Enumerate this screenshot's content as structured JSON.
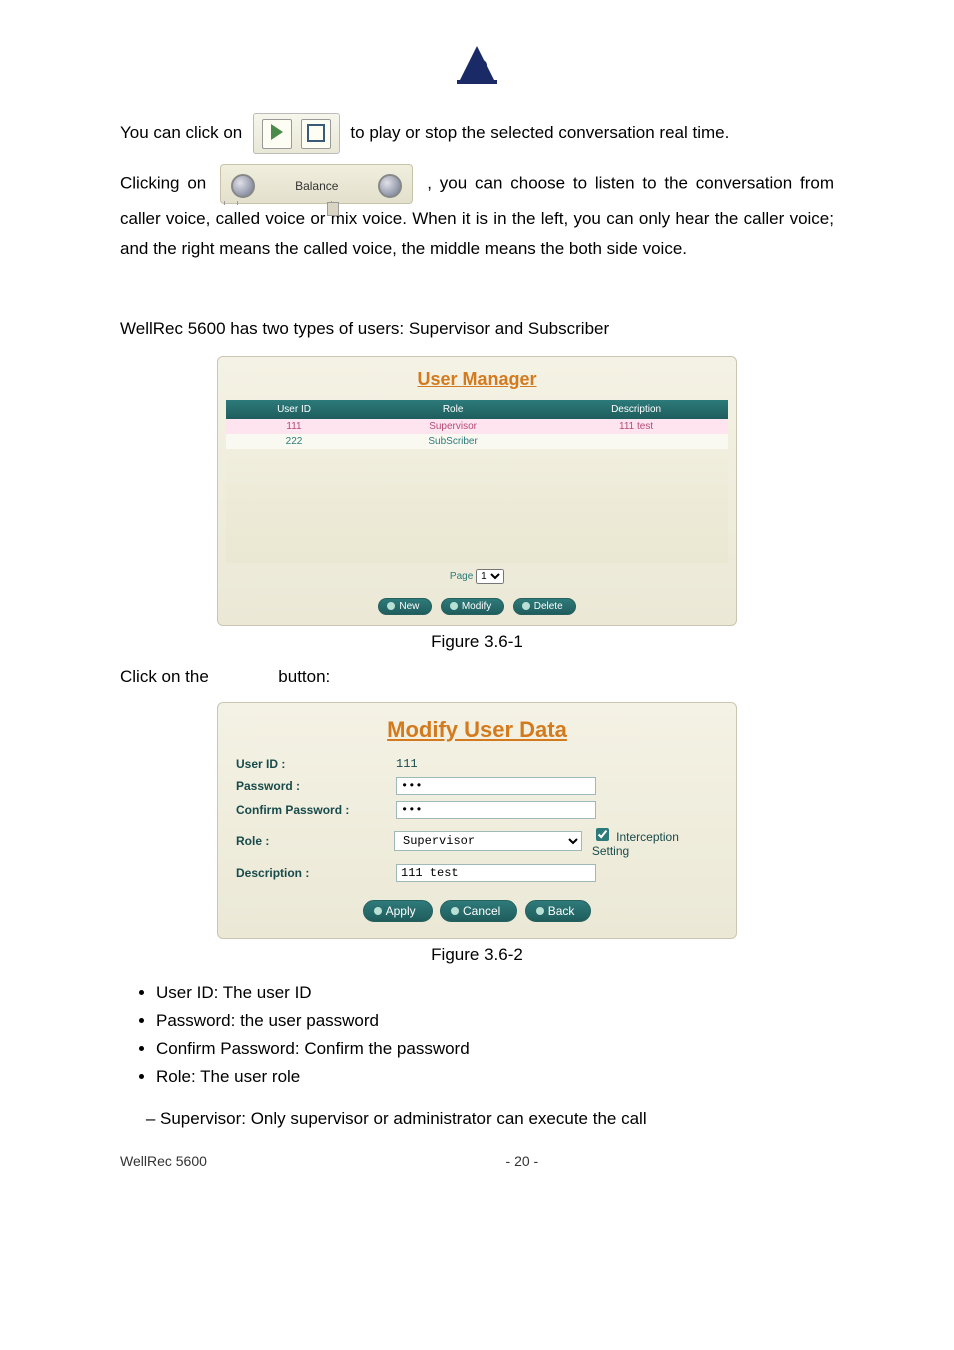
{
  "intro": {
    "line1_pre": "You can click on ",
    "line1_post": " to play or stop the selected conversation real time.",
    "balance_label": "Balance",
    "line2_pre": "Clicking on ",
    "line2_post": ", you can choose to listen to the conversation from caller voice, called voice or mix voice. When it is in the left, you can only hear the caller voice; and the right means the called voice, the middle means the both side voice."
  },
  "section_line": "WellRec 5600 has two types of users: Supervisor and Subscriber",
  "user_manager": {
    "title": "User Manager",
    "cols": [
      "User ID",
      "Role",
      "Description"
    ],
    "rows": [
      {
        "id": "111",
        "role": "Supervisor",
        "desc": "111 test"
      },
      {
        "id": "222",
        "role": "SubScriber",
        "desc": ""
      }
    ],
    "pager_label": "Page",
    "pager_value": "1",
    "buttons": {
      "new": "New",
      "modify": "Modify",
      "delete": "Delete"
    }
  },
  "fig1": "Figure 3.6-1",
  "between": {
    "pre": "Click on the",
    "post": "button:"
  },
  "modify_user": {
    "title": "Modify User Data",
    "labels": {
      "user_id": "User ID :",
      "password": "Password :",
      "confirm": "Confirm Password :",
      "role": "Role :",
      "description": "Description :"
    },
    "values": {
      "user_id": "111",
      "password": "•••",
      "confirm": "•••",
      "role": "Supervisor",
      "interception": "Interception Setting",
      "description": "111 test"
    },
    "buttons": {
      "apply": "Apply",
      "cancel": "Cancel",
      "back": "Back"
    }
  },
  "fig2": "Figure 3.6-2",
  "bullets": {
    "b1": "User ID: The user ID",
    "b2": "Password: the user password",
    "b3": "Confirm Password: Confirm the password",
    "b4": "Role: The user role",
    "b4s1": "Supervisor: Only supervisor or administrator can execute the call"
  },
  "footer": {
    "product": "WellRec 5600",
    "page": "- 20 -"
  }
}
